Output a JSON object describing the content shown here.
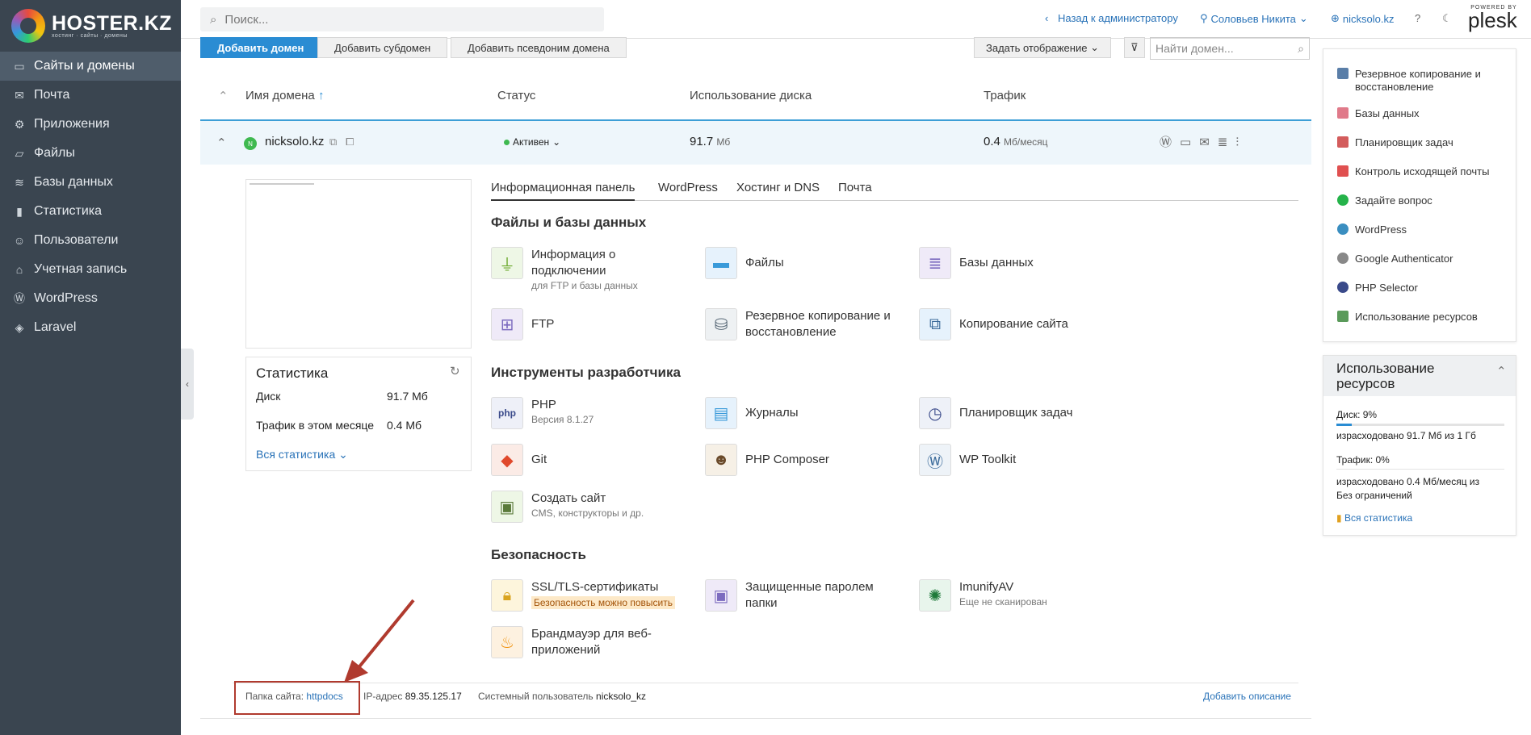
{
  "brand": {
    "logo_main": "HOSTER.KZ",
    "logo_sub": "хостинг · сайты · домены",
    "powered_by": "POWERED BY",
    "plesk": "plesk"
  },
  "sidebar": {
    "items": [
      {
        "label": "Сайты и домены",
        "icon": "monitor-icon"
      },
      {
        "label": "Почта",
        "icon": "mail-icon"
      },
      {
        "label": "Приложения",
        "icon": "gear-icon"
      },
      {
        "label": "Файлы",
        "icon": "folder-icon"
      },
      {
        "label": "Базы данных",
        "icon": "layers-icon"
      },
      {
        "label": "Статистика",
        "icon": "bar-chart-icon"
      },
      {
        "label": "Пользователи",
        "icon": "user-icon"
      },
      {
        "label": "Учетная запись",
        "icon": "account-icon"
      },
      {
        "label": "WordPress",
        "icon": "wordpress-icon"
      },
      {
        "label": "Laravel",
        "icon": "laravel-icon"
      }
    ]
  },
  "topbar": {
    "search_placeholder": "Поиск...",
    "back_admin": "Назад к администратору",
    "user": "Соловьев Никита",
    "domain": "nicksolo.kz"
  },
  "toolbar": {
    "add_domain": "Добавить домен",
    "add_subdomain": "Добавить субдомен",
    "add_alias": "Добавить псевдоним домена",
    "view": "Задать отображение",
    "find_placeholder": "Найти домен..."
  },
  "table": {
    "col_name": "Имя домена",
    "col_status": "Статус",
    "col_disk": "Использование диска",
    "col_traffic": "Трафик"
  },
  "domain_row": {
    "name": "nicksolo.kz",
    "status": "Активен",
    "disk_value": "91.7",
    "disk_unit": "Мб",
    "traffic_value": "0.4",
    "traffic_unit": "Мб/месяц"
  },
  "stats": {
    "title": "Статистика",
    "disk_label": "Диск",
    "disk_value": "91.7 Мб",
    "traffic_label": "Трафик в этом месяце",
    "traffic_value": "0.4 Мб",
    "all_stats": "Вся статистика"
  },
  "tabs": [
    "Информационная панель",
    "WordPress",
    "Хостинг и DNS",
    "Почта"
  ],
  "sections": {
    "files_db": "Файлы и базы данных",
    "dev": "Инструменты разработчика",
    "security": "Безопасность"
  },
  "tools": {
    "conn_info": {
      "name": "Информация о подключении",
      "sub": "для FTP и базы данных"
    },
    "files": {
      "name": "Файлы"
    },
    "databases": {
      "name": "Базы данных"
    },
    "ftp": {
      "name": "FTP"
    },
    "backup": {
      "name": "Резервное копирование и восстановление"
    },
    "copy_site": {
      "name": "Копирование сайта"
    },
    "php": {
      "name": "PHP",
      "sub": "Версия 8.1.27"
    },
    "logs": {
      "name": "Журналы"
    },
    "scheduler": {
      "name": "Планировщик задач"
    },
    "git": {
      "name": "Git"
    },
    "composer": {
      "name": "PHP Composer"
    },
    "wptoolkit": {
      "name": "WP Toolkit"
    },
    "create_site": {
      "name": "Создать сайт",
      "sub": "CMS, конструкторы и др."
    },
    "ssl": {
      "name": "SSL/TLS-сертификаты",
      "badge": "Безопасность можно повысить"
    },
    "protected": {
      "name": "Защищенные паролем папки"
    },
    "imunify": {
      "name": "ImunifyAV",
      "sub": "Еще не сканирован"
    },
    "firewall": {
      "name": "Брандмауэр для веб-приложений"
    }
  },
  "footer": {
    "folder_label": "Папка сайта:",
    "folder_value": "httpdocs",
    "ip_label": "IP-адрес",
    "ip_value": "89.35.125.17",
    "sysuser_label": "Системный пользователь",
    "sysuser_value": "nicksolo_kz",
    "add_desc": "Добавить описание"
  },
  "right_panel": {
    "items": [
      {
        "label": "Резервное копирование и восстановление",
        "icon": "backup-icon",
        "color": "#5a7ea8"
      },
      {
        "label": "Базы данных",
        "icon": "database-icon",
        "color": "#e07a8a"
      },
      {
        "label": "Планировщик задач",
        "icon": "calendar-icon",
        "color": "#d35c5c"
      },
      {
        "label": "Контроль исходящей почты",
        "icon": "mail-outgoing-icon",
        "color": "#e05050"
      },
      {
        "label": "Задайте вопрос",
        "icon": "whatsapp-icon",
        "color": "#25b34a"
      },
      {
        "label": "WordPress",
        "icon": "wordpress-icon",
        "color": "#3a8ec0"
      },
      {
        "label": "Google Authenticator",
        "icon": "google-auth-icon",
        "color": "#888888"
      },
      {
        "label": "PHP Selector",
        "icon": "php-icon",
        "color": "#3a4a8a"
      },
      {
        "label": "Использование ресурсов",
        "icon": "usage-icon",
        "color": "#5a9a5a"
      }
    ],
    "usage": {
      "title": "Использование ресурсов",
      "disk_label": "Диск: 9%",
      "disk_used": "израсходовано 91.7 Мб из 1 Гб",
      "disk_fraction": 0.09,
      "traffic_label": "Трафик: 0%",
      "traffic_used": "израсходовано 0.4 Мб/месяц из Без ограничений",
      "all_stats": "Вся статистика"
    }
  },
  "colors": {
    "sidebar_bg": "#3a4550",
    "accent": "#2a8cd3",
    "annotation": "#b03a2e"
  }
}
